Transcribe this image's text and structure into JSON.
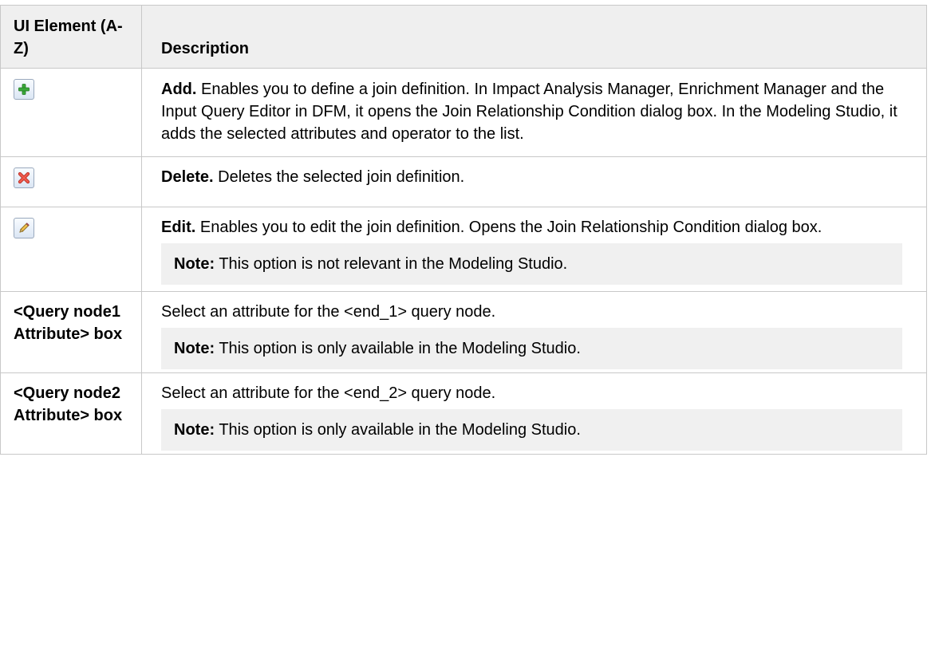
{
  "table": {
    "header": {
      "col1": "UI Element (A-Z)",
      "col2": "Description"
    },
    "rows": [
      {
        "element_icon": "add-plus-icon",
        "term": "Add.",
        "text": "Enables you to define a join definition. In Impact Analysis Manager, Enrichment Manager and the Input Query Editor in DFM, it opens the Join Relationship Condition dialog box. In the Modeling Studio, it adds the selected attributes and operator to the list."
      },
      {
        "element_icon": "delete-x-icon",
        "term": "Delete.",
        "text": "Deletes the selected join definition."
      },
      {
        "element_icon": "edit-pencil-icon",
        "term": "Edit.",
        "text": "Enables you to edit the join definition. Opens the Join Relationship Condition dialog box.",
        "note_label": "Note:",
        "note_text": "This option is not relevant in the Modeling Studio."
      },
      {
        "element_text": "<Query node1 Attribute> box",
        "text": "Select an attribute for the <end_1> query node.",
        "note_label": "Note:",
        "note_text": "This option is only available in the Modeling Studio."
      },
      {
        "element_text": "<Query node2 Attribute> box",
        "text": "Select an attribute for the <end_2> query node.",
        "note_label": "Note:",
        "note_text": "This option is only available in the Modeling Studio."
      }
    ]
  },
  "colors": {
    "header_bg": "#efefef",
    "note_bg": "#f0f0f0",
    "border": "#c8c8c8",
    "add_icon_green": "#3aa93a",
    "delete_icon_red": "#e0443a"
  }
}
